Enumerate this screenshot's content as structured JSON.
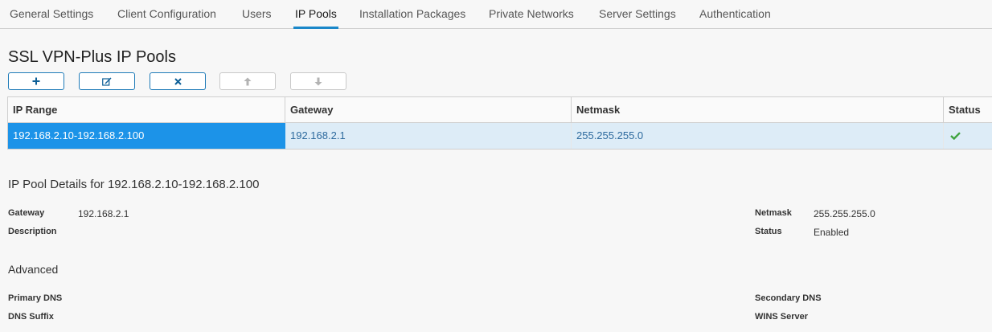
{
  "tabs": [
    {
      "label": "General Settings",
      "active": false
    },
    {
      "label": "Client Configuration",
      "active": false
    },
    {
      "label": "Users",
      "active": false
    },
    {
      "label": "IP Pools",
      "active": true
    },
    {
      "label": "Installation Packages",
      "active": false
    },
    {
      "label": "Private Networks",
      "active": false
    },
    {
      "label": "Server Settings",
      "active": false
    },
    {
      "label": "Authentication",
      "active": false
    }
  ],
  "page_title": "SSL VPN-Plus IP Pools",
  "toolbar": {
    "buttons": [
      {
        "icon": "add-icon",
        "enabled": true
      },
      {
        "icon": "edit-icon",
        "enabled": true
      },
      {
        "icon": "delete-icon",
        "enabled": true
      },
      {
        "icon": "move-up-icon",
        "enabled": false
      },
      {
        "icon": "move-down-icon",
        "enabled": false
      }
    ]
  },
  "grid": {
    "columns": [
      "IP Range",
      "Gateway",
      "Netmask",
      "Status"
    ],
    "rows": [
      {
        "ip_range": "192.168.2.10-192.168.2.100",
        "gateway": "192.168.2.1",
        "netmask": "255.255.255.0",
        "status_icon": "check-icon",
        "selected": true
      }
    ]
  },
  "details": {
    "title": "IP Pool Details for 192.168.2.10-192.168.2.100",
    "gateway_label": "Gateway",
    "gateway_value": "192.168.2.1",
    "description_label": "Description",
    "netmask_label": "Netmask",
    "netmask_value": "255.255.255.0",
    "status_label": "Status",
    "status_value": "Enabled",
    "advanced_title": "Advanced",
    "primary_dns_label": "Primary DNS",
    "secondary_dns_label": "Secondary DNS",
    "dns_suffix_label": "DNS Suffix",
    "wins_server_label": "WINS Server"
  },
  "colors": {
    "accent": "#1a87c9",
    "selected_row": "#1c93e8",
    "row_highlight": "#ddecf7",
    "status_ok": "#3fa33f"
  }
}
